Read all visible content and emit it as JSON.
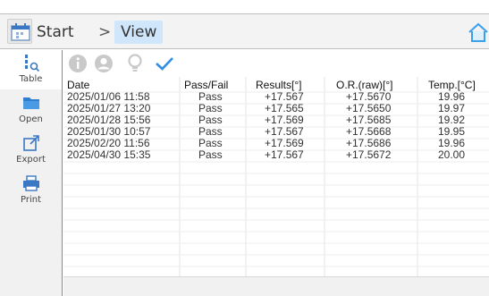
{
  "header": {
    "breadcrumb_start": "Start",
    "breadcrumb_separator": ">",
    "breadcrumb_current": "View"
  },
  "sidebar": {
    "items": [
      {
        "label": "Table",
        "icon": "table-icon",
        "active": true
      },
      {
        "label": "Open",
        "icon": "folder-icon",
        "active": false
      },
      {
        "label": "Export",
        "icon": "export-icon",
        "active": false
      },
      {
        "label": "Print",
        "icon": "printer-icon",
        "active": false
      }
    ]
  },
  "toolbar": {
    "icons": [
      "info-icon",
      "user-icon",
      "lightbulb-icon",
      "checkmark-icon"
    ]
  },
  "table": {
    "columns": [
      "Date",
      "Pass/Fail",
      "Results[°]",
      "O.R.(raw)[°]",
      "Temp.[°C]"
    ],
    "rows": [
      [
        "2025/01/06 11:58",
        "Pass",
        "+17.567",
        "+17.5670",
        "19.96"
      ],
      [
        "2025/01/27 13:20",
        "Pass",
        "+17.565",
        "+17.5650",
        "19.97"
      ],
      [
        "2025/01/28 15:56",
        "Pass",
        "+17.569",
        "+17.5685",
        "19.92"
      ],
      [
        "2025/01/30 10:57",
        "Pass",
        "+17.567",
        "+17.5668",
        "19.95"
      ],
      [
        "2025/02/20 11:56",
        "Pass",
        "+17.569",
        "+17.5686",
        "19.96"
      ],
      [
        "2025/04/30 15:35",
        "Pass",
        "+17.567",
        "+17.5672",
        "20.00"
      ]
    ]
  },
  "colors": {
    "accent": "#2f8fe6",
    "breadcrumb_highlight": "#cfe6fb",
    "toolbar_icon": "#c9c9c9",
    "home_icon": "#39a0ee"
  }
}
